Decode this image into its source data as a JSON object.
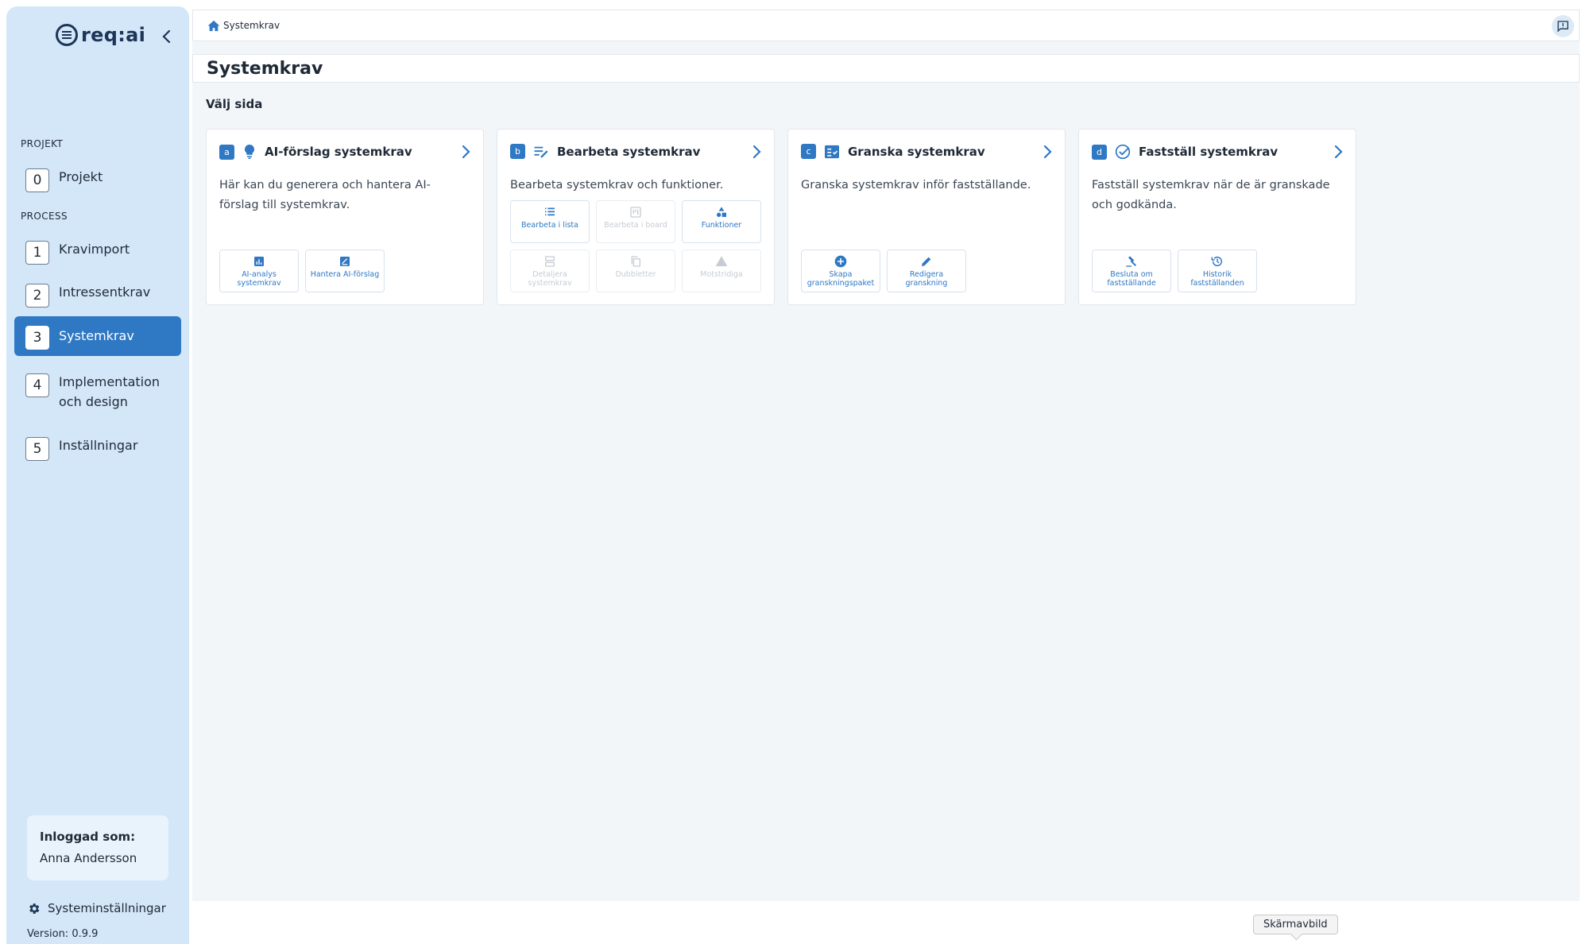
{
  "app": {
    "logo_text": "req:ai"
  },
  "sidebar": {
    "projekt_label": "PROJEKT",
    "process_label": "PROCESS",
    "items": [
      {
        "num": "0",
        "label": "Projekt"
      },
      {
        "num": "1",
        "label": "Kravimport"
      },
      {
        "num": "2",
        "label": "Intressentkrav"
      },
      {
        "num": "3",
        "label": "Systemkrav"
      },
      {
        "num": "4",
        "label": "Implementation och design"
      },
      {
        "num": "5",
        "label": "Inställningar"
      }
    ],
    "active_item": "Systemkrav",
    "user": {
      "label": "Inloggad som:",
      "name": "Anna Andersson"
    },
    "system_settings": "Systeminställningar",
    "version": "Version: 0.9.9"
  },
  "breadcrumb": {
    "home_icon": "home-icon",
    "current": "Systemkrav"
  },
  "page": {
    "title": "Systemkrav",
    "subtitle": "Välj sida"
  },
  "cards": [
    {
      "badge": "a",
      "icon": "lightbulb-icon",
      "title": "AI-förslag systemkrav",
      "desc": "Här kan du generera och hantera AI-förslag till systemkrav.",
      "actions": [
        {
          "label": "AI-analys systemkrav",
          "icon": "analytics-icon",
          "enabled": true
        },
        {
          "label": "Hantera AI-förslag",
          "icon": "edit-note-icon",
          "enabled": true
        }
      ]
    },
    {
      "badge": "b",
      "icon": "edit-list-icon",
      "title": "Bearbeta systemkrav",
      "desc": "Bearbeta systemkrav och funktioner.",
      "actions": [
        {
          "label": "Bearbeta i lista",
          "icon": "list-icon",
          "enabled": true
        },
        {
          "label": "Bearbeta i board",
          "icon": "board-icon",
          "enabled": false
        },
        {
          "label": "Funktioner",
          "icon": "shapes-icon",
          "enabled": true
        },
        {
          "label": "Detaljera systemkrav",
          "icon": "split-icon",
          "enabled": false
        },
        {
          "label": "Dubbletter",
          "icon": "copy-icon",
          "enabled": false
        },
        {
          "label": "Motstridiga",
          "icon": "warning-icon",
          "enabled": false
        }
      ]
    },
    {
      "badge": "c",
      "icon": "checklist-icon",
      "title": "Granska systemkrav",
      "desc": "Granska systemkrav inför fastställande.",
      "actions": [
        {
          "label": "Skapa granskningspaket",
          "icon": "add-circle-icon",
          "enabled": true
        },
        {
          "label": "Redigera granskning",
          "icon": "pencil-icon",
          "enabled": true
        }
      ]
    },
    {
      "badge": "d",
      "icon": "check-circle-icon",
      "title": "Fastställ systemkrav",
      "desc": "Fastställ systemkrav när de är granskade och godkända.",
      "actions": [
        {
          "label": "Besluta om fastställande",
          "icon": "gavel-icon",
          "enabled": true
        },
        {
          "label": "Historik fastställanden",
          "icon": "history-icon",
          "enabled": true
        }
      ]
    }
  ],
  "tooltip": "Skärmavbild",
  "colors": {
    "accent": "#2f78c4",
    "sidebar_bg": "#d3e7f9",
    "main_bg": "#f2f6f9",
    "text": "#1f2a37",
    "disabled": "#c6ccd3"
  }
}
